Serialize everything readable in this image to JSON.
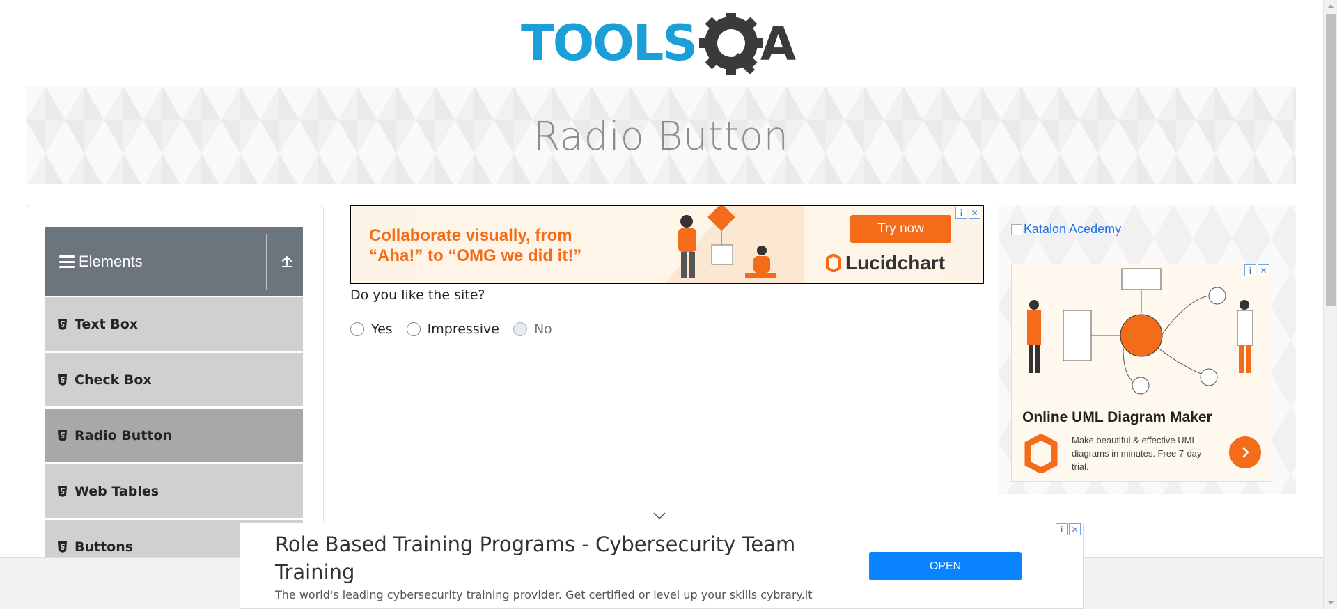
{
  "header": {
    "logo_alt": "TOOLSQA"
  },
  "banner": {
    "title": "Radio Button"
  },
  "sidebar": {
    "group_title": "Elements",
    "items": [
      {
        "label": "Text Box"
      },
      {
        "label": "Check Box"
      },
      {
        "label": "Radio Button",
        "active": true
      },
      {
        "label": "Web Tables"
      },
      {
        "label": "Buttons"
      }
    ]
  },
  "ad_top": {
    "headline_line1": "Collaborate visually, from",
    "headline_line2": "“Aha!” to “OMG we did it!”",
    "cta": "Try now",
    "brand": "Lucidchart"
  },
  "form": {
    "question": "Do you like the site?",
    "options": [
      {
        "label": "Yes",
        "disabled": false
      },
      {
        "label": "Impressive",
        "disabled": false
      },
      {
        "label": "No",
        "disabled": true
      }
    ]
  },
  "right_ad": {
    "katalon_alt": "Katalon Acedemy",
    "title": "Online UML Diagram Maker",
    "description": "Make beautiful & effective UML diagrams in minutes. Free 7-day trial."
  },
  "bottom_ad": {
    "headline": "Role Based Training Programs - Cybersecurity Team Training",
    "subtext": "The world's leading cybersecurity training provider. Get certified or level up your skills cybrary.it",
    "cta": "OPEN"
  },
  "colors": {
    "accent_orange": "#f46b1a",
    "sidebar_header": "#6c757d",
    "toolsqa_blue": "#1a9fd9",
    "toolsqa_dark": "#333333"
  }
}
